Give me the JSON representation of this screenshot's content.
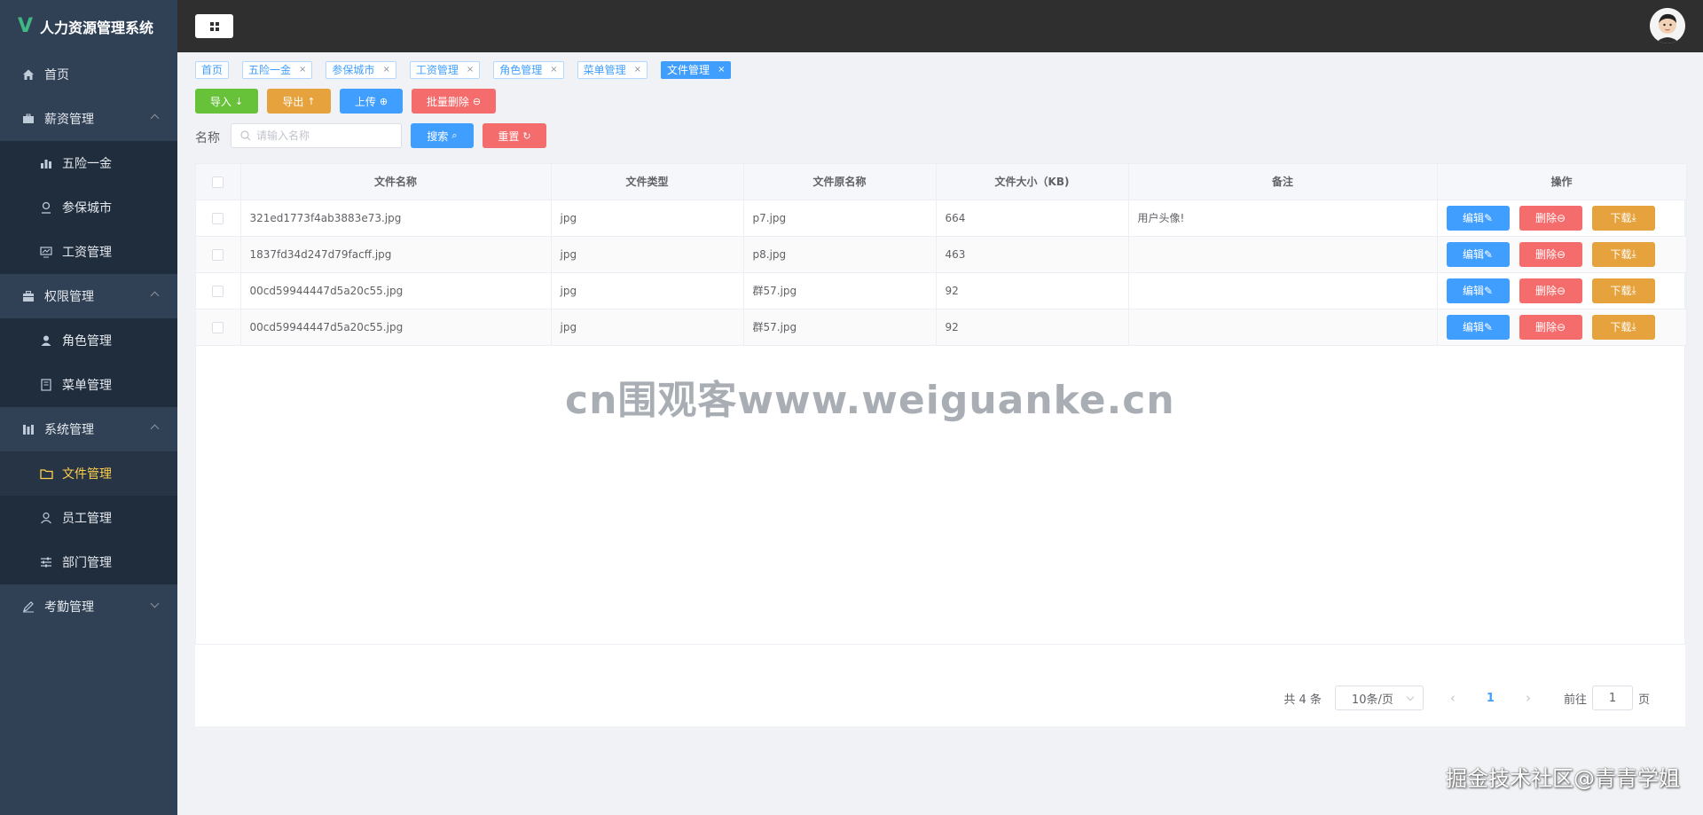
{
  "app": {
    "title": "人力资源管理系统",
    "logo_letter": "V"
  },
  "sidebar": {
    "items": [
      {
        "label": "首页",
        "icon": "home-icon"
      },
      {
        "label": "薪资管理",
        "icon": "suitcase-icon",
        "expanded": true
      },
      {
        "label": "五险一金",
        "icon": "bar-chart-icon"
      },
      {
        "label": "参保城市",
        "icon": "location-icon"
      },
      {
        "label": "工资管理",
        "icon": "monitor-icon"
      },
      {
        "label": "权限管理",
        "icon": "briefcase-icon",
        "expanded": true
      },
      {
        "label": "角色管理",
        "icon": "user-icon"
      },
      {
        "label": "菜单管理",
        "icon": "document-icon"
      },
      {
        "label": "系统管理",
        "icon": "library-icon",
        "expanded": true
      },
      {
        "label": "文件管理",
        "icon": "folder-icon",
        "active": true
      },
      {
        "label": "员工管理",
        "icon": "person-icon"
      },
      {
        "label": "部门管理",
        "icon": "sliders-icon"
      },
      {
        "label": "考勤管理",
        "icon": "edit-icon",
        "expanded": false
      }
    ]
  },
  "tags": [
    {
      "label": "首页",
      "closable": false
    },
    {
      "label": "五险一金",
      "closable": true
    },
    {
      "label": "参保城市",
      "closable": true
    },
    {
      "label": "工资管理",
      "closable": true
    },
    {
      "label": "角色管理",
      "closable": true
    },
    {
      "label": "菜单管理",
      "closable": true
    },
    {
      "label": "文件管理",
      "closable": true,
      "active": true
    }
  ],
  "tag_close": "×",
  "toolbar": {
    "import": "导入",
    "export": "导出",
    "upload": "上传",
    "batch_delete": "批量删除"
  },
  "search": {
    "label": "名称",
    "placeholder": "请输入名称",
    "value": "",
    "search_btn": "搜索",
    "reset_btn": "重置"
  },
  "table": {
    "columns": [
      "文件名称",
      "文件类型",
      "文件原名称",
      "文件大小（KB)",
      "备注",
      "操作"
    ],
    "rows": [
      {
        "name": "321ed1773f4ab3883e73.jpg",
        "type": "jpg",
        "original": "p7.jpg",
        "size": "664",
        "remark": "用户头像!"
      },
      {
        "name": "1837fd34d247d79facff.jpg",
        "type": "jpg",
        "original": "p8.jpg",
        "size": "463",
        "remark": ""
      },
      {
        "name": "00cd59944447d5a20c55.jpg",
        "type": "jpg",
        "original": "群57.jpg",
        "size": "92",
        "remark": ""
      },
      {
        "name": "00cd59944447d5a20c55.jpg",
        "type": "jpg",
        "original": "群57.jpg",
        "size": "92",
        "remark": ""
      }
    ],
    "actions": {
      "edit": "编辑",
      "delete": "删除",
      "download": "下载"
    }
  },
  "pagination": {
    "total": "共 4 条",
    "page_size": "10条/页",
    "current": "1",
    "goto_prefix": "前往",
    "goto_value": "1",
    "goto_suffix": "页"
  },
  "watermark": "cn围观客www.weiguanke.cn",
  "corner_watermark": "掘金技术社区@青青学姐",
  "colors": {
    "sidebar": "#304156",
    "header": "#2f2f2f",
    "primary": "#409eff",
    "success": "#67c23a",
    "warning": "#e6a23c",
    "danger": "#f56c6c",
    "active_menu": "#ffd04b"
  }
}
